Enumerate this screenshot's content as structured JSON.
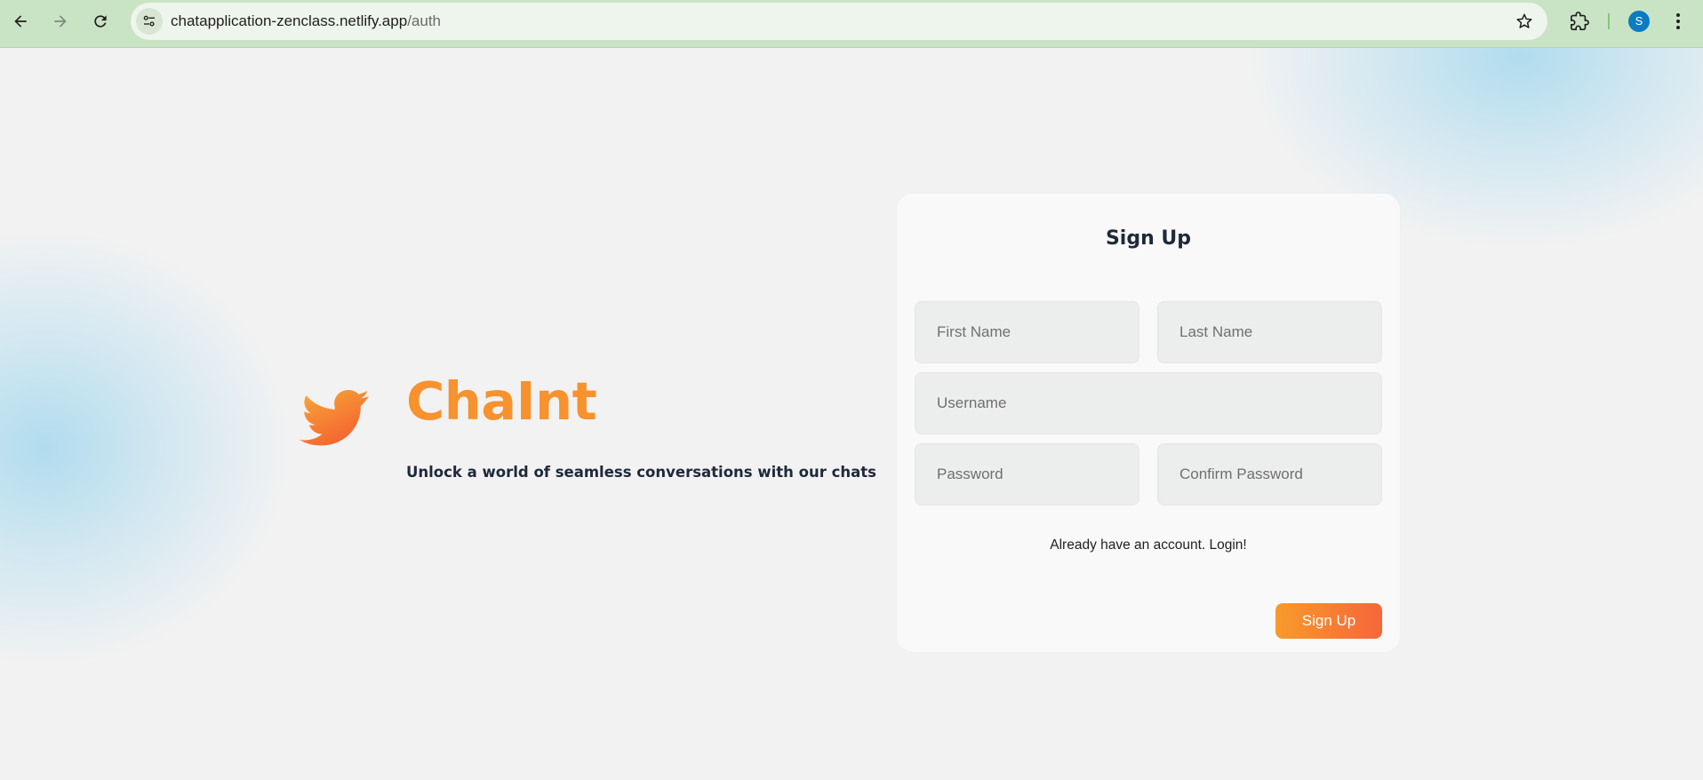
{
  "browser": {
    "url_host": "chatapplication-zenclass.netlify.app",
    "url_path": "/auth",
    "profile_initial": "S",
    "icons": {
      "back": "back-arrow-icon",
      "forward": "forward-arrow-icon",
      "reload": "reload-icon",
      "site_info": "tune-icon",
      "bookmark": "star-icon",
      "extensions": "puzzle-icon",
      "menu": "kebab-menu-icon"
    }
  },
  "brand": {
    "name": "ChaInt",
    "tagline": "Unlock a world of seamless conversations with our chats",
    "logo_icon": "bird-icon",
    "color": "#f7922d"
  },
  "signup": {
    "title": "Sign Up",
    "fields": {
      "first_name_placeholder": "First Name",
      "last_name_placeholder": "Last Name",
      "username_placeholder": "Username",
      "password_placeholder": "Password",
      "confirm_password_placeholder": "Confirm Password"
    },
    "login_prompt": "Already have an account. Login!",
    "submit_label": "Sign Up",
    "button_gradient": [
      "#f89a2c",
      "#f5663a"
    ]
  }
}
